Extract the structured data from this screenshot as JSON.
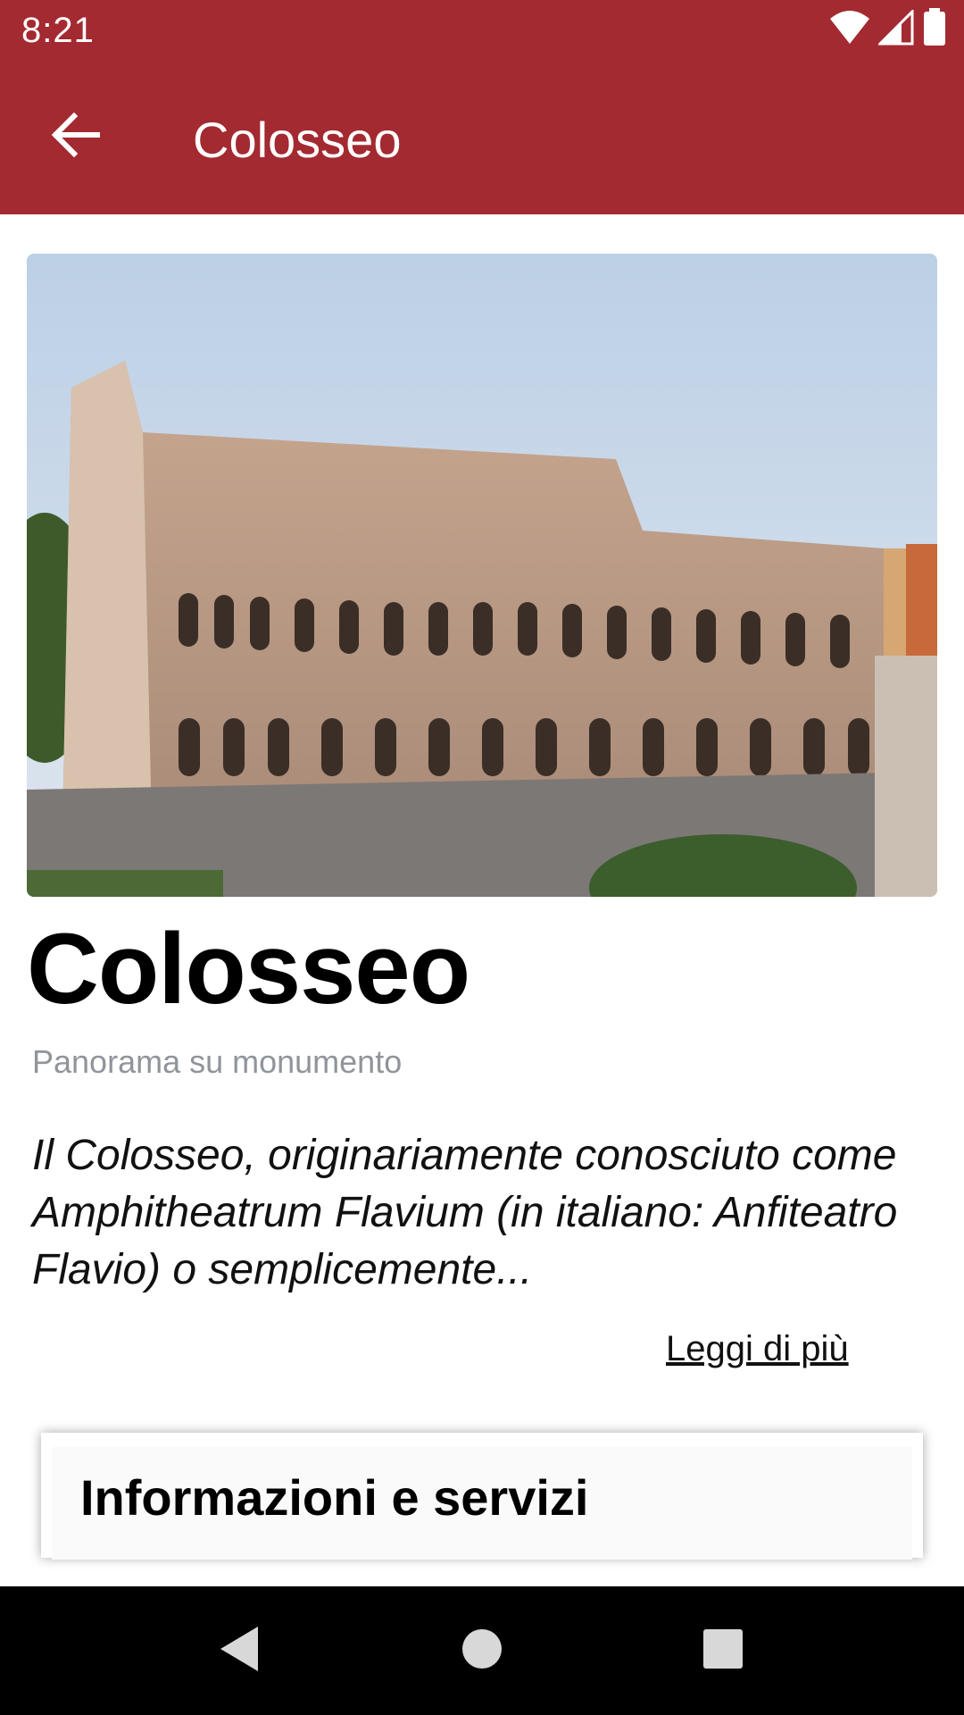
{
  "status_bar": {
    "time": "8:21",
    "icons": [
      "wifi-icon",
      "cellular-signal-icon",
      "battery-icon"
    ]
  },
  "app_bar": {
    "title": "Colosseo",
    "back_icon": "arrow-back-icon",
    "color": "#a32a31"
  },
  "hero_image": {
    "subject": "Colosseum photograph"
  },
  "content": {
    "title": "Colosseo",
    "subtitle": "Panorama su monumento",
    "description": "Il Colosseo, originariamente conosciuto come Amphitheatrum Flavium (in italiano: Anfiteatro Flavio) o semplicemente...",
    "read_more": "Leggi di più"
  },
  "info_card": {
    "title": "Informazioni e servizi"
  },
  "nav_bar": {
    "buttons": [
      "back-triangle-icon",
      "home-circle-icon",
      "recents-square-icon"
    ]
  }
}
